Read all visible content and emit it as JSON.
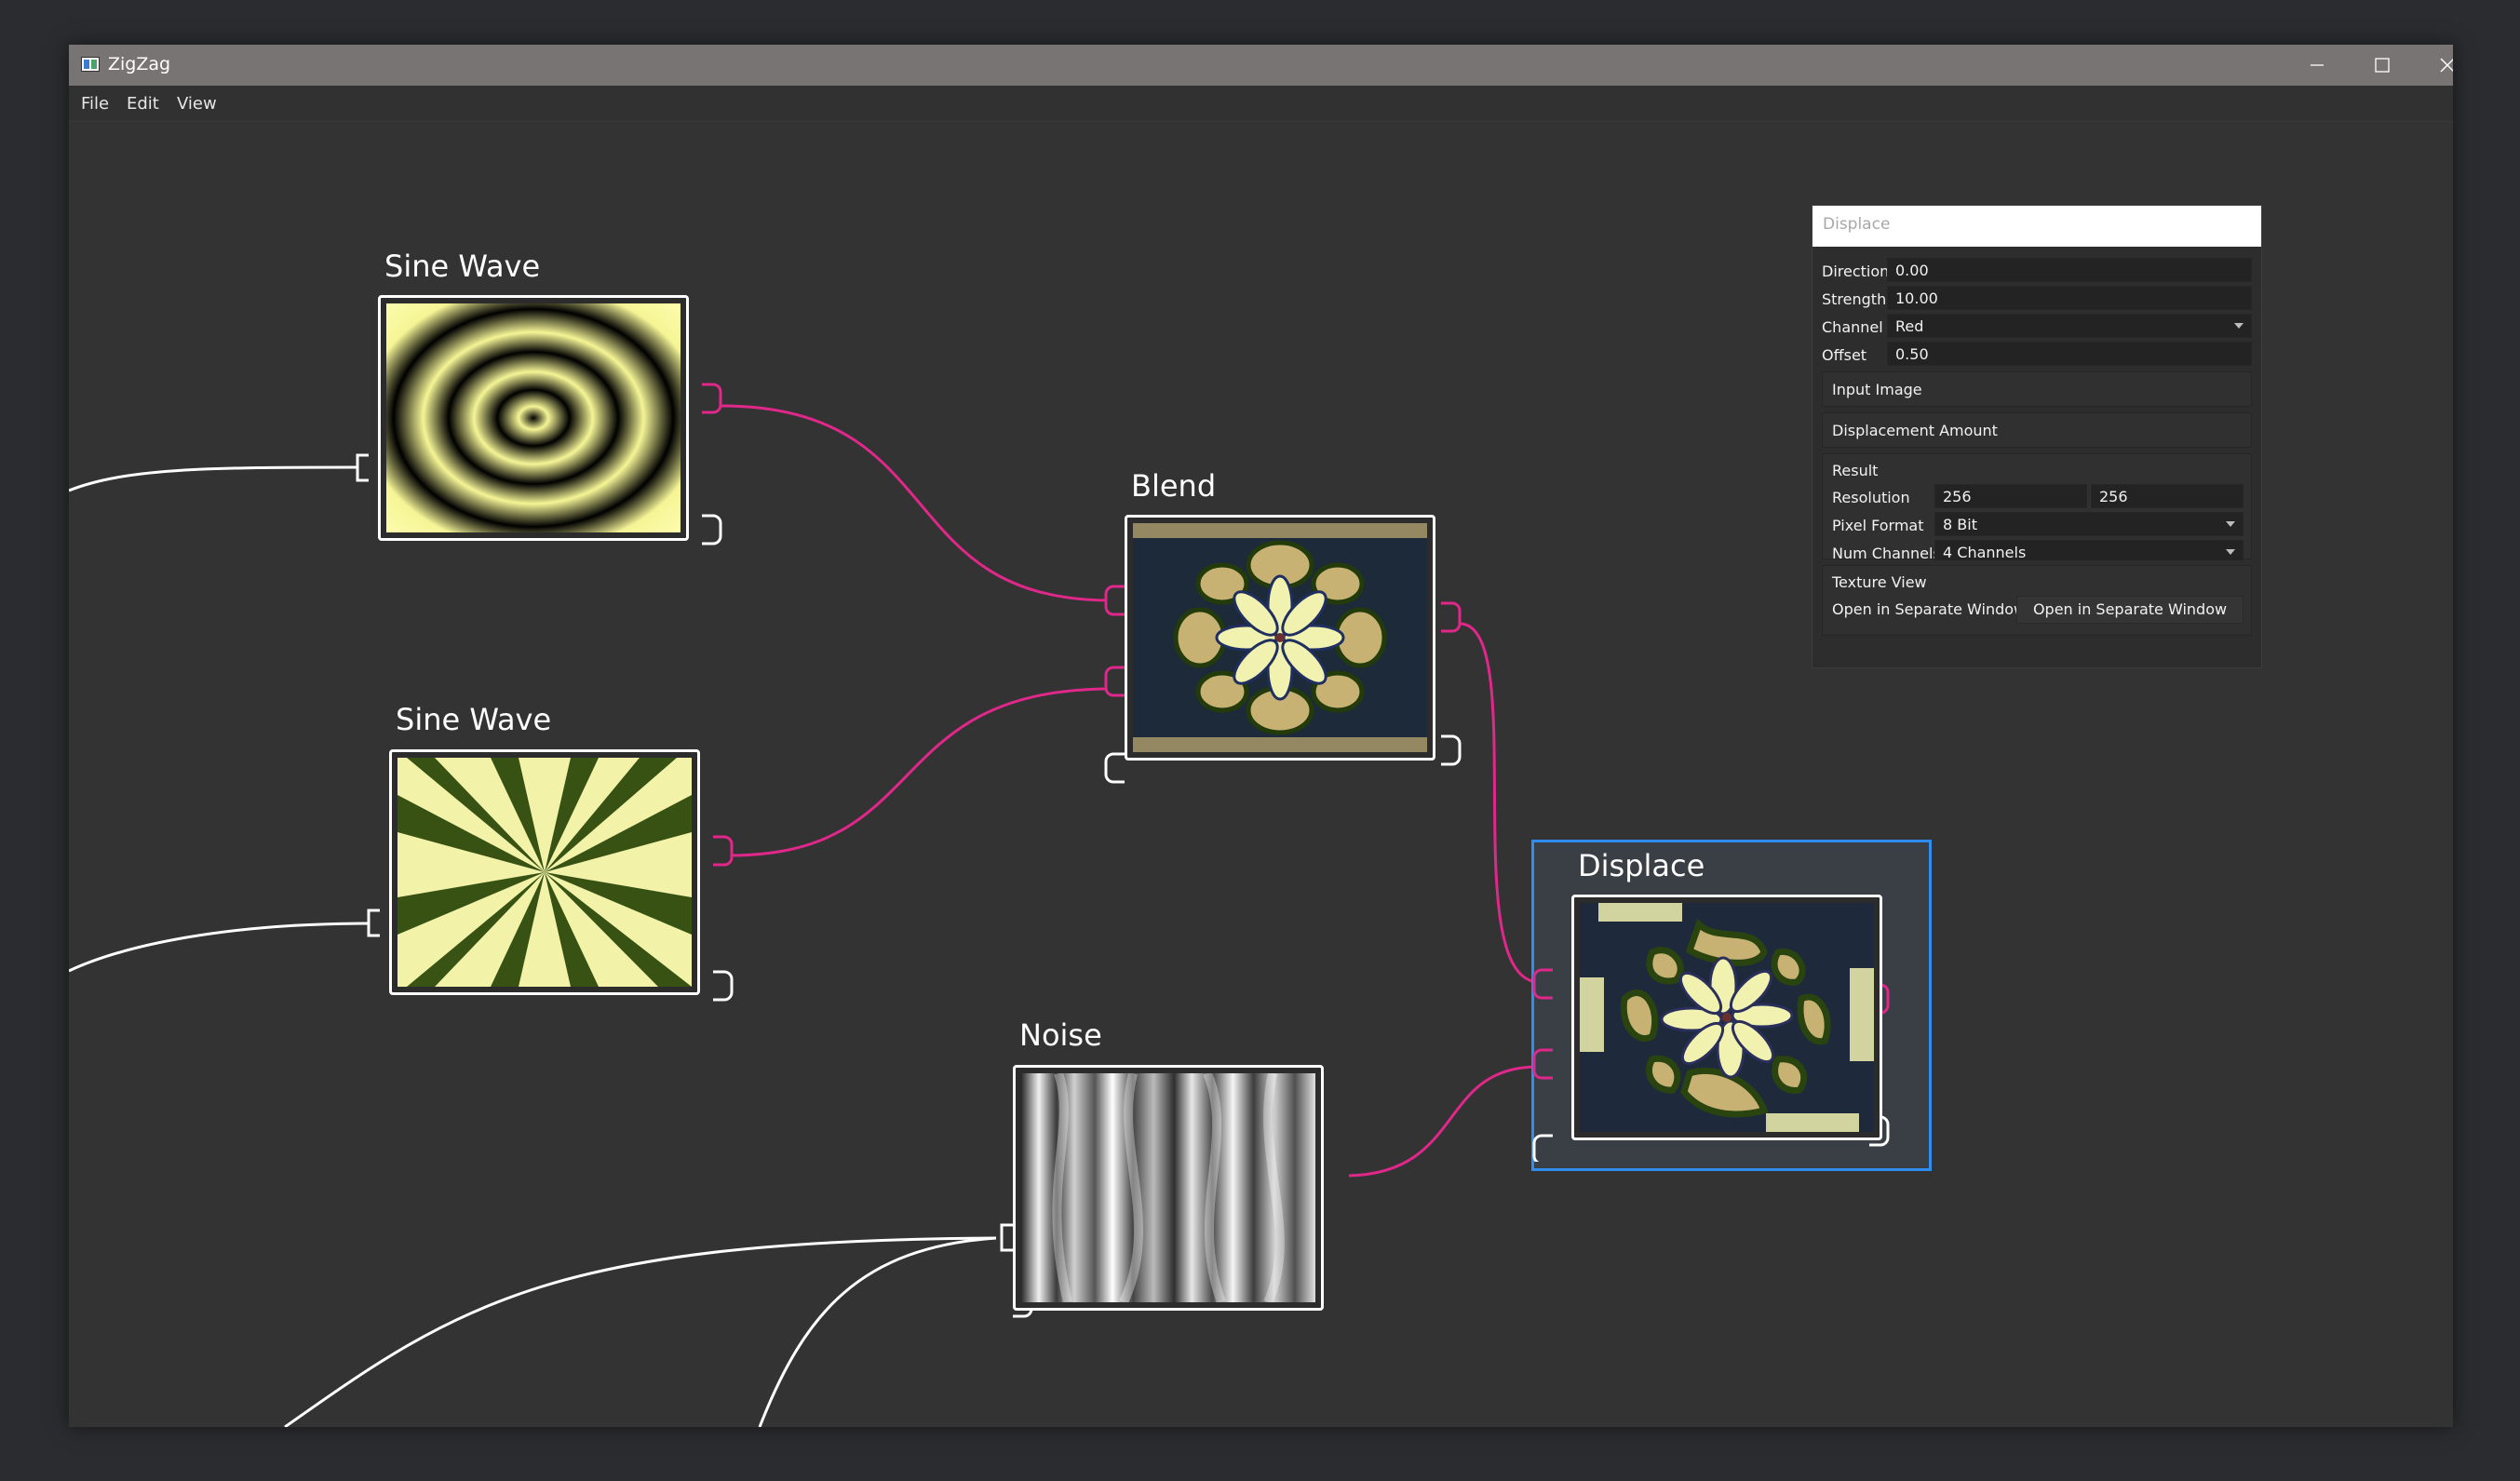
{
  "window": {
    "title": "ZigZag"
  },
  "menu": [
    "File",
    "Edit",
    "View"
  ],
  "nodes": [
    {
      "id": "sine-wave-1",
      "title": "Sine Wave"
    },
    {
      "id": "sine-wave-2",
      "title": "Sine Wave"
    },
    {
      "id": "blend",
      "title": "Blend"
    },
    {
      "id": "noise",
      "title": "Noise"
    },
    {
      "id": "displace",
      "title": "Displace",
      "selected": true
    }
  ],
  "wire_colors": {
    "active": "#e0278a",
    "inactive": "#ffffff",
    "selection": "#2f8df0"
  },
  "properties": {
    "header": "Displace",
    "direction": {
      "label": "Direction",
      "value": "0.00"
    },
    "strength": {
      "label": "Strength",
      "value": "10.00"
    },
    "channel": {
      "label": "Channel",
      "value": "Red"
    },
    "offset": {
      "label": "Offset",
      "value": "0.50"
    },
    "input_image": "Input Image",
    "displacement_amount": "Displacement Amount",
    "result": {
      "title": "Result",
      "resolution": {
        "label": "Resolution",
        "width": "256",
        "height": "256"
      },
      "pixel_format": {
        "label": "Pixel Format",
        "value": "8 Bit"
      },
      "num_channels": {
        "label": "Num Channels",
        "value": "4 Channels"
      }
    },
    "texture_view": {
      "title": "Texture View",
      "label": "Open in Separate Window",
      "button": "Open in Separate Window"
    }
  }
}
